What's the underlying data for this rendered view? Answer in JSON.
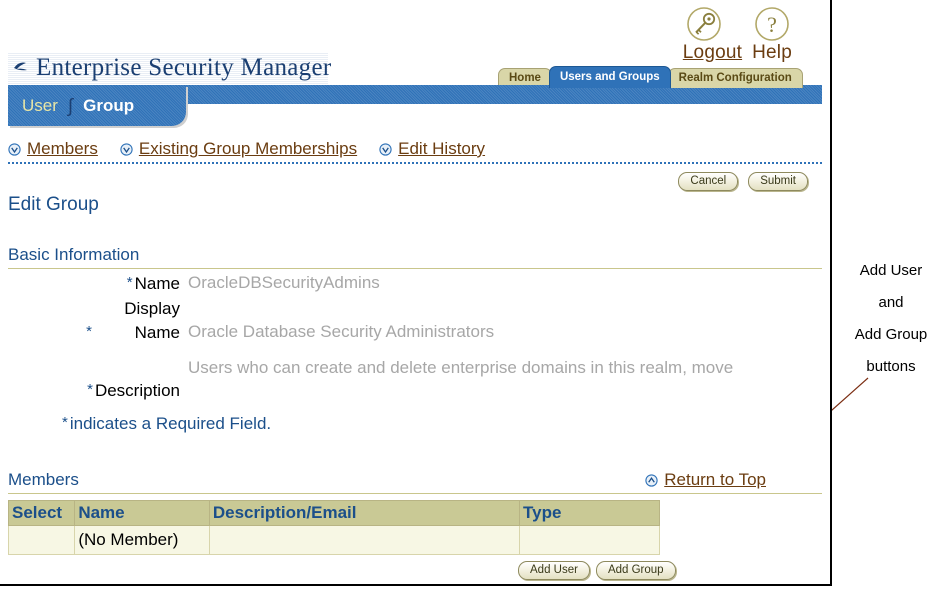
{
  "app": {
    "title": "Enterprise Security Manager",
    "logo_icon": "globe-logo-icon"
  },
  "globals": {
    "logout": {
      "label": "Logout",
      "icon": "key-icon"
    },
    "help": {
      "label": "Help",
      "icon": "question-mark-icon"
    }
  },
  "top_tabs": [
    {
      "label": "Home",
      "selected": false
    },
    {
      "label": "Users and Groups",
      "selected": true
    },
    {
      "label": "Realm Configuration",
      "selected": false
    }
  ],
  "sub_tabs": {
    "separator": "∫",
    "items": [
      {
        "label": "User",
        "selected": false
      },
      {
        "label": "Group",
        "selected": true
      }
    ]
  },
  "quick_links": [
    {
      "label": "Members",
      "icon": "chevron-down-circle-icon"
    },
    {
      "label": "Existing Group Memberships",
      "icon": "chevron-down-circle-icon"
    },
    {
      "label": "Edit History",
      "icon": "chevron-down-circle-icon"
    }
  ],
  "actions": {
    "cancel": "Cancel",
    "submit": "Submit"
  },
  "page": {
    "heading": "Edit Group",
    "basic_information_heading": "Basic Information",
    "required_note": "indicates a Required Field.",
    "required_marker": "*"
  },
  "fields": [
    {
      "label": "Name",
      "required": true,
      "value": "OracleDBSecurityAdmins"
    },
    {
      "label": "Display Name",
      "required": true,
      "value": "Oracle Database Security Administrators"
    },
    {
      "label": "Description",
      "required": true,
      "value": "Users who can  create and delete enterprise domains in this realm, move"
    }
  ],
  "members": {
    "heading": "Members",
    "return_to_top": {
      "label": "Return to Top",
      "icon": "chevron-up-circle-icon"
    },
    "columns": [
      "Select",
      "Name",
      "Description/Email",
      "Type"
    ],
    "rows": [
      {
        "select": "",
        "name": "(No Member)",
        "description": "",
        "type": ""
      }
    ],
    "buttons": {
      "add_user": "Add User",
      "add_group": "Add Group"
    }
  },
  "annotation": {
    "lines": [
      "Add User",
      "and",
      "Add Group",
      "buttons"
    ],
    "leader_color": "#7b2d12"
  },
  "colors": {
    "bar_blue": "#2f72b8",
    "tab_khaki": "#d9d6a8",
    "link_brown": "#6b3d11",
    "heading_blue": "#1b4f8a",
    "table_header": "#c9c995",
    "table_row": "#f7f7e4",
    "value_grey": "#a7a7a7"
  }
}
